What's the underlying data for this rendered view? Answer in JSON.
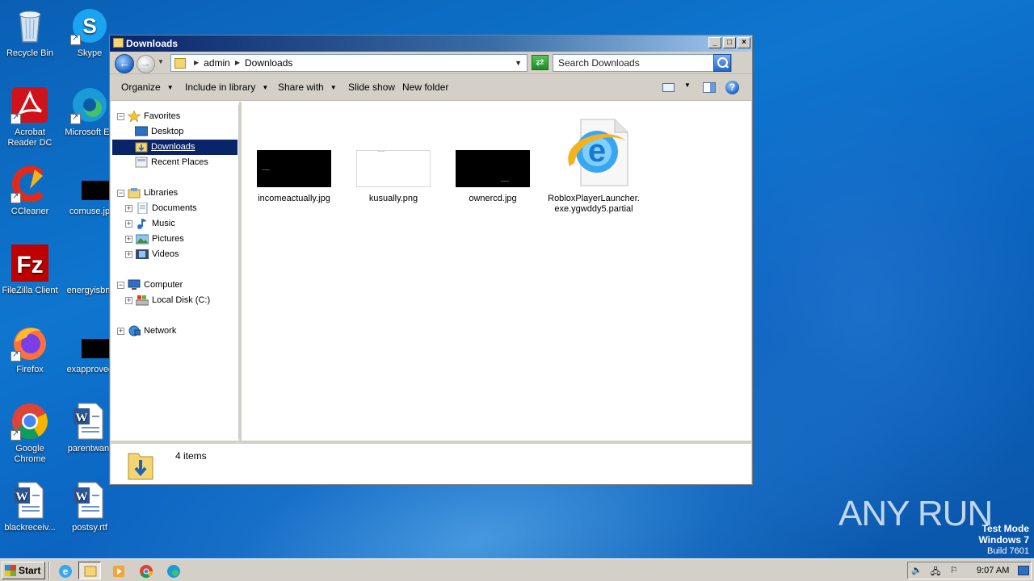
{
  "desktop": {
    "icons": [
      {
        "label": "Recycle Bin",
        "icon": "recycle-bin-icon"
      },
      {
        "label": "Skype",
        "icon": "skype-icon"
      },
      {
        "label": "Acrobat Reader DC",
        "icon": "acrobat-icon"
      },
      {
        "label": "Microsoft Ed",
        "icon": "edge-icon"
      },
      {
        "label": "CCleaner",
        "icon": "ccleaner-icon"
      },
      {
        "label": "comuse.jp",
        "icon": "image-file-icon"
      },
      {
        "label": "FileZilla Client",
        "icon": "filezilla-icon"
      },
      {
        "label": "energyisbn.",
        "icon": "image-file-icon"
      },
      {
        "label": "Firefox",
        "icon": "firefox-icon"
      },
      {
        "label": "exapprovec",
        "icon": "image-file-icon"
      },
      {
        "label": "Google Chrome",
        "icon": "chrome-icon"
      },
      {
        "label": "parentwant",
        "icon": "word-doc-icon"
      },
      {
        "label": "blackreceiv...",
        "icon": "word-doc-icon"
      },
      {
        "label": "postsy.rtf",
        "icon": "word-doc-icon"
      }
    ]
  },
  "window": {
    "title": "Downloads",
    "controls": {
      "minimize": "_",
      "maximize": "□",
      "close": "×"
    },
    "address": {
      "segments": [
        "admin",
        "Downloads"
      ]
    },
    "search": {
      "placeholder": "Search Downloads"
    },
    "toolbar": {
      "organize": "Organize",
      "include_in_library": "Include in library",
      "share_with": "Share with",
      "slide_show": "Slide show",
      "new_folder": "New folder",
      "help": "?"
    },
    "nav": {
      "favorites": "Favorites",
      "desktop": "Desktop",
      "downloads": "Downloads",
      "recent_places": "Recent Places",
      "libraries": "Libraries",
      "documents": "Documents",
      "music": "Music",
      "pictures": "Pictures",
      "videos": "Videos",
      "computer": "Computer",
      "local_disk": "Local Disk (C:)",
      "network": "Network"
    },
    "files": [
      {
        "name": "incomeactually.jpg",
        "icon": "black-image-thumbnail"
      },
      {
        "name": "kusually.png",
        "icon": "white-image-thumbnail"
      },
      {
        "name": "ownercd.jpg",
        "icon": "black-image-thumbnail"
      },
      {
        "name": "RobloxPlayerLauncher.exe.ygwddy5.partial",
        "icon": "internet-explorer-icon"
      }
    ],
    "status": {
      "item_count": "4 items"
    }
  },
  "watermark": {
    "text": "ANY RUN"
  },
  "test_mode": {
    "line1": "Test Mode",
    "line2": "Windows 7",
    "line3": "Build 7601"
  },
  "taskbar": {
    "start": "Start",
    "clock": "9:07 AM"
  }
}
